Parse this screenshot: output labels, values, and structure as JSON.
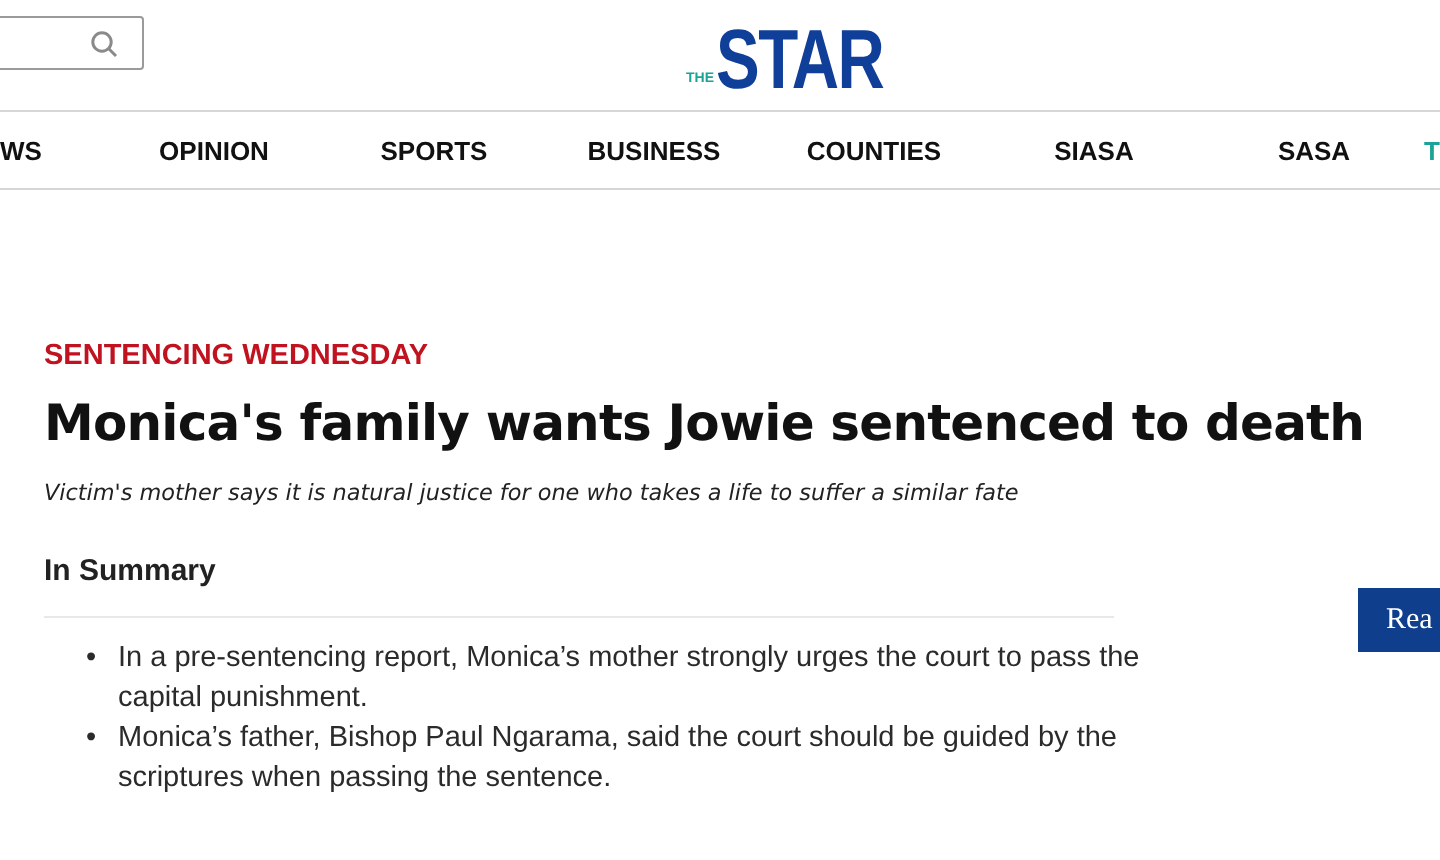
{
  "header": {
    "logo": {
      "small": "THE",
      "main": "STAR"
    }
  },
  "nav": [
    {
      "label": "WS",
      "color": "#111111"
    },
    {
      "label": "OPINION",
      "color": "#111111"
    },
    {
      "label": "SPORTS",
      "color": "#111111"
    },
    {
      "label": "BUSINESS",
      "color": "#111111"
    },
    {
      "label": "COUNTIES",
      "color": "#111111"
    },
    {
      "label": "SIASA",
      "color": "#111111"
    },
    {
      "label": "SASA",
      "color": "#111111"
    },
    {
      "label": "T",
      "color": "#1aa396"
    }
  ],
  "article": {
    "kicker": "SENTENCING WEDNESDAY",
    "headline": "Monica's family wants Jowie sentenced to death",
    "standfirst": "Victim's mother says it is natural justice for one who takes a life to suffer a similar fate",
    "summary_heading": "In Summary",
    "summary": [
      {
        "marker": "•",
        "text": "In a pre-sentencing report, Monica’s mother strongly urges the court to pass the capital punishment."
      },
      {
        "marker": "•",
        "text": "Monica’s father, Bishop Paul Ngarama, said the court should be guided by the scriptures when passing the sentence."
      }
    ]
  },
  "side_button": {
    "label": "Rea"
  }
}
